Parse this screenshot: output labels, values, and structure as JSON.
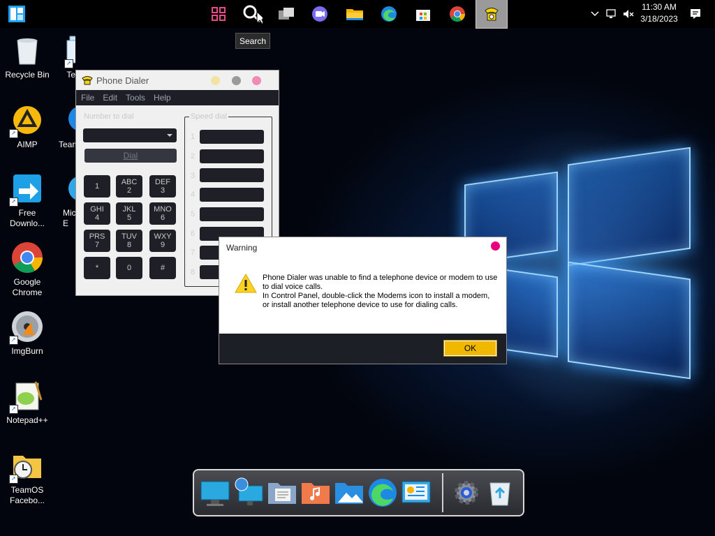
{
  "taskbar": {
    "start_icon": "start-tiles-icon",
    "items": [
      {
        "name": "widgets-icon"
      },
      {
        "name": "search-icon"
      },
      {
        "name": "task-view-icon"
      },
      {
        "name": "teams-chat-icon"
      },
      {
        "name": "file-explorer-icon"
      },
      {
        "name": "edge-icon"
      },
      {
        "name": "microsoft-store-icon"
      },
      {
        "name": "chrome-icon"
      },
      {
        "name": "phone-dialer-icon"
      }
    ],
    "tooltip": "Search",
    "clock_time": "11:30 AM",
    "clock_date": "3/18/2023"
  },
  "desktop": {
    "icons": [
      {
        "label": "Recycle Bin"
      },
      {
        "label": "Te"
      },
      {
        "label": "AIMP"
      },
      {
        "label": "Team"
      },
      {
        "label": "Free Downlo..."
      },
      {
        "label": "Mic E"
      },
      {
        "label": "Google Chrome"
      },
      {
        "label": "ImgBurn"
      },
      {
        "label": "Notepad++"
      },
      {
        "label": "TeamOS Facebo..."
      }
    ]
  },
  "dialer": {
    "title": "Phone Dialer",
    "menu": [
      "File",
      "Edit",
      "Tools",
      "Help"
    ],
    "number_label": "Number to dial",
    "dial_label": "Dial",
    "speed_label": "Speed dial",
    "keys": [
      {
        "top": "",
        "bottom": "1"
      },
      {
        "top": "ABC",
        "bottom": "2"
      },
      {
        "top": "DEF",
        "bottom": "3"
      },
      {
        "top": "GHI",
        "bottom": "4"
      },
      {
        "top": "JKL",
        "bottom": "5"
      },
      {
        "top": "MNO",
        "bottom": "6"
      },
      {
        "top": "PRS",
        "bottom": "7"
      },
      {
        "top": "TUV",
        "bottom": "8"
      },
      {
        "top": "WXY",
        "bottom": "9"
      },
      {
        "top": "",
        "bottom": "*"
      },
      {
        "top": "",
        "bottom": "0"
      },
      {
        "top": "",
        "bottom": "#"
      }
    ],
    "speed_numbers": [
      "1",
      "2",
      "3",
      "4",
      "5",
      "6",
      "7",
      "8"
    ]
  },
  "warning": {
    "title": "Warning",
    "line1": "Phone Dialer was unable to find a telephone device or modem to use to dial voice calls.",
    "line2": "In Control Panel, double-click the Modems icon to install a modem, or install another telephone device to use for dialing calls.",
    "ok_label": "OK"
  },
  "dock": {
    "items": [
      {
        "name": "monitor-icon"
      },
      {
        "name": "network-globe-icon"
      },
      {
        "name": "documents-folder-icon"
      },
      {
        "name": "music-folder-icon"
      },
      {
        "name": "pictures-folder-icon"
      },
      {
        "name": "edge-icon"
      },
      {
        "name": "control-panel-icon"
      },
      {
        "name": "settings-gear-icon"
      },
      {
        "name": "recycle-bin-icon"
      }
    ]
  },
  "colors": {
    "accent_ok": "#f0b800",
    "close_pink": "#e8007d",
    "dialer_dark": "#1f1f27"
  }
}
